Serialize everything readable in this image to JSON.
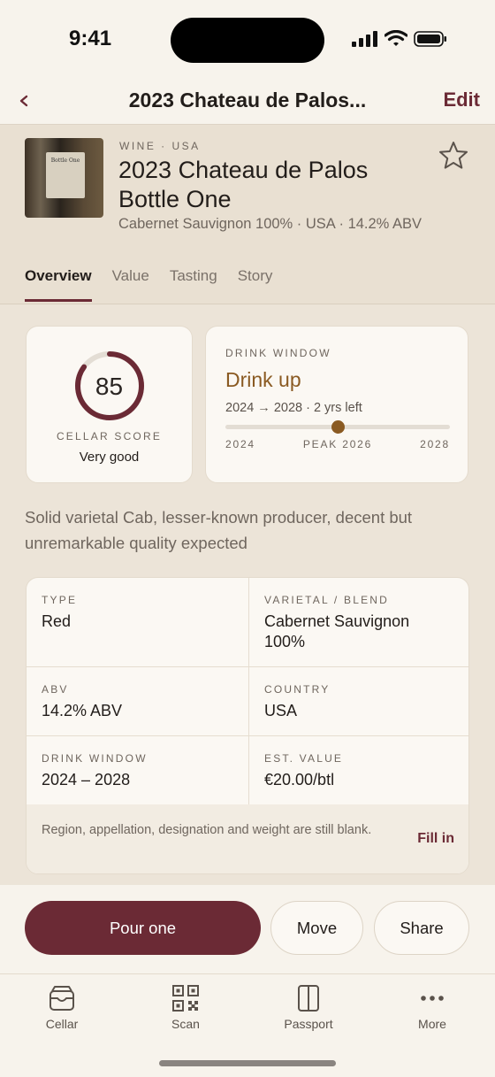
{
  "status": {
    "time": "9:41"
  },
  "nav": {
    "title": "2023 Chateau de Palos...",
    "edit": "Edit"
  },
  "header": {
    "kicker": "WINE · USA",
    "title_line1": "2023 Chateau de Palos",
    "title_line2": "Bottle One",
    "subtitle": "Cabernet Sauvignon 100% · USA · 14.2% ABV",
    "bottle_label": "Bottle One"
  },
  "tabs": [
    "Overview",
    "Value",
    "Tasting",
    "Story"
  ],
  "score": {
    "value": "85",
    "fraction": 0.85,
    "label": "CELLAR SCORE",
    "desc": "Very good"
  },
  "drink_window": {
    "label": "DRINK WINDOW",
    "status": "Drink up",
    "range": "2024 → 2028 · 2 yrs left",
    "start": 2024,
    "peak": 2026,
    "end": 2028,
    "tick_start": "2024",
    "tick_peak": "PEAK 2026",
    "tick_end": "2028"
  },
  "summary": "Solid varietal Cab, lesser-known producer, decent but unremarkable quality expected",
  "details": {
    "type_k": "TYPE",
    "type_v": "Red",
    "varietal_k": "VARIETAL / BLEND",
    "varietal_v": "Cabernet Sauvignon 100%",
    "abv_k": "ABV",
    "abv_v": "14.2% ABV",
    "country_k": "COUNTRY",
    "country_v": "USA",
    "window_k": "DRINK WINDOW",
    "window_v": "2024 – 2028",
    "value_k": "EST. VALUE",
    "value_v": "€20.00/btl",
    "blank_note": "Region, appellation, designation and weight are still blank.",
    "fill_in": "Fill in"
  },
  "actions": {
    "pour": "Pour one",
    "move": "Move",
    "share": "Share"
  },
  "tabbar": {
    "cellar": "Cellar",
    "scan": "Scan",
    "passport": "Passport",
    "more": "More"
  },
  "colors": {
    "accent": "#6b2a35",
    "gold": "#8a5a22",
    "background": "#ece4d8"
  }
}
